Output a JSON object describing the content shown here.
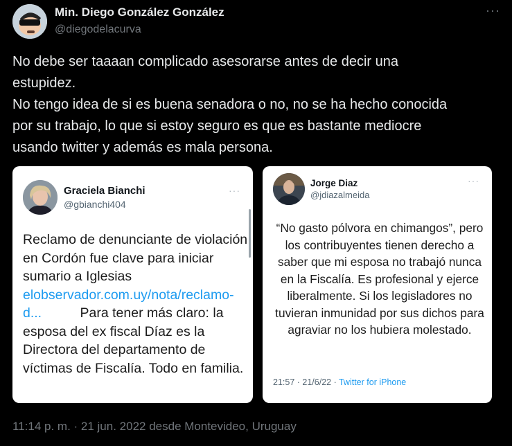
{
  "author": {
    "name": "Min. Diego González González",
    "handle": "@diegodelacurva"
  },
  "tweet": {
    "lines": [
      "No debe ser taaaan complicado asesorarse antes de decir una",
      "estupidez.",
      "No tengo idea de si es buena senadora o no, no se ha hecho conocida",
      "por su trabajo, lo que si estoy seguro es que es bastante mediocre",
      "usando twitter y además es mala persona."
    ]
  },
  "media": {
    "left": {
      "name": "Graciela Bianchi",
      "handle": "@gbianchi404",
      "text_before_link": "Reclamo de denunciante de violación en Cordón fue clave para iniciar sumario a Iglesias",
      "link": "elobservador.com.uy/nota/reclamo-d...",
      "text_after_link": "Para tener más claro: la esposa del ex fiscal Díaz es la Directora del departamento de víctimas de Fiscalía. Todo en familia."
    },
    "right": {
      "name": "Jorge Diaz",
      "handle": "@jdiazalmeida",
      "text": "“No gasto pólvora en chimangos”, pero los contribuyentes tienen derecho a saber que mi esposa no trabajó nunca en la Fiscalía. Es profesional  y ejerce  liberalmente. Si los legisladores no tuvieran inmunidad por sus dichos para agraviar no los hubiera molestado.",
      "time": "21:57 · 21/6/22 ·",
      "source": "Twitter for iPhone"
    }
  },
  "footer": {
    "meta": "11:14 p. m. · 21 jun. 2022 desde Montevideo, Uruguay"
  },
  "icons": {
    "more": "more-options-icon",
    "avatar": "avatar-image"
  }
}
